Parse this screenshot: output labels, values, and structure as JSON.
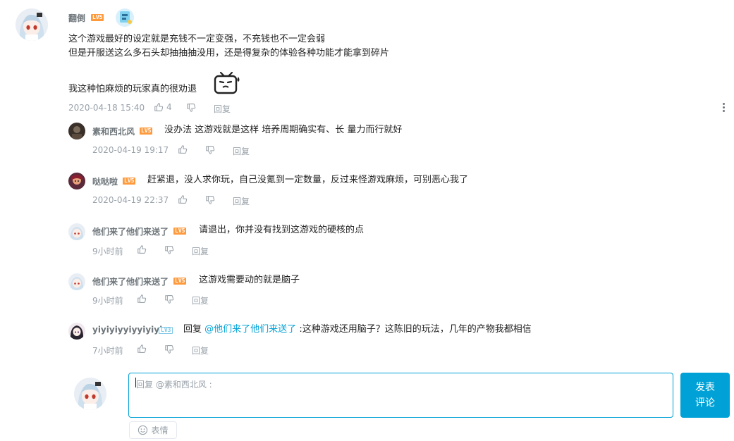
{
  "main_comment": {
    "username": "翻倒",
    "level": "LV5",
    "text_line1": "这个游戏最好的设定就是充钱不一定变强，不充钱也不一定会弱",
    "text_line2": "但是开服送这么多石头却抽抽抽没用，还是得复杂的体验各种功能才能拿到碎片",
    "text_line3": "我这种怕麻烦的玩家真的很劝退",
    "date": "2020-04-18 15:40",
    "likes": "4",
    "reply_label": "回复",
    "emoji_icon": "bilibili-tv-sweat-emoji"
  },
  "replies": [
    {
      "username": "素和西北风",
      "level": "LV5",
      "text": "没办法 这游戏就是这样 培养周期确实有、长 量力而行就好",
      "date": "2020-04-19 19:17",
      "reply_label": "回复"
    },
    {
      "username": "哒哒啦",
      "level": "LV5",
      "text": "赶紧退，没人求你玩，自己没氪到一定数量，反过来怪游戏麻烦，可别恶心我了",
      "date": "2020-04-19 22:37",
      "reply_label": "回复"
    },
    {
      "username": "他们来了他们来送了",
      "level": "LV5",
      "text": "请退出，你并没有找到这游戏的硬核的点",
      "date": "9小时前",
      "reply_label": "回复"
    },
    {
      "username": "他们来了他们来送了",
      "level": "LV5",
      "text": "这游戏需要动的就是脑子",
      "date": "9小时前",
      "reply_label": "回复"
    },
    {
      "username": "yiyiyiyyiyyiyiyi",
      "level": "LV3",
      "reply_prefix": "回复",
      "mention": "@他们来了他们来送了",
      "text": ":这种游戏还用脑子？这陈旧的玩法，几年的产物我都相信",
      "date": "7小时前",
      "reply_label": "回复"
    }
  ],
  "composer": {
    "placeholder": "回复 @素和西北风 :",
    "submit_line1": "发表",
    "submit_line2": "评论",
    "emoji_label": "表情"
  },
  "colors": {
    "accent": "#00a1d6",
    "level_orange": "#ff9a3c",
    "meta_gray": "#99a2aa",
    "username_gray": "#6d757a"
  }
}
